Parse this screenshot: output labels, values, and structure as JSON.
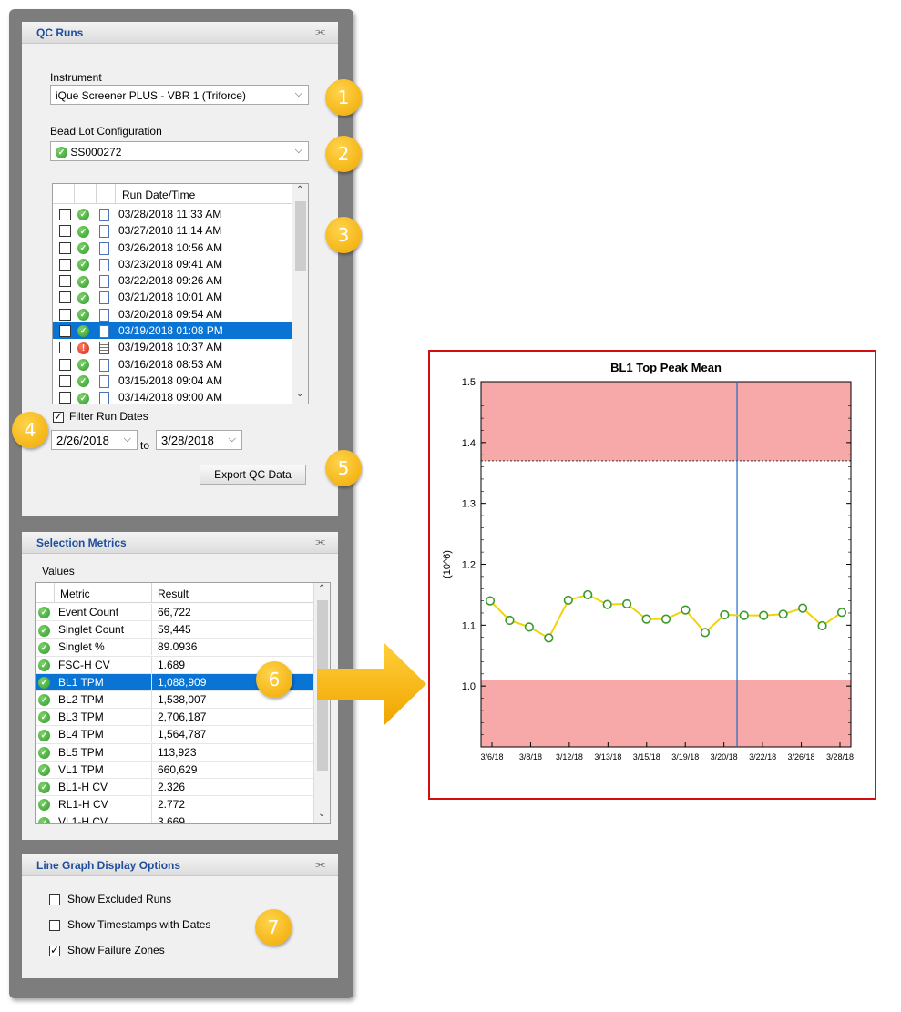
{
  "qc_runs": {
    "header": "QC Runs",
    "collapse_icon": "double-chevron-up-icon",
    "instrument_label": "Instrument",
    "instrument_value": "iQue Screener PLUS - VBR 1 (Triforce)",
    "bead_lot_label": "Bead Lot Configuration",
    "bead_lot_value": "SS000272",
    "runs_header": "Run Date/Time",
    "runs": [
      {
        "date": "03/28/2018 11:33 AM",
        "status": "ok",
        "selected": false
      },
      {
        "date": "03/27/2018 11:14 AM",
        "status": "ok",
        "selected": false
      },
      {
        "date": "03/26/2018 10:56 AM",
        "status": "ok",
        "selected": false
      },
      {
        "date": "03/23/2018 09:41 AM",
        "status": "ok",
        "selected": false
      },
      {
        "date": "03/22/2018 09:26 AM",
        "status": "ok",
        "selected": false
      },
      {
        "date": "03/21/2018 10:01 AM",
        "status": "ok",
        "selected": false
      },
      {
        "date": "03/20/2018 09:54 AM",
        "status": "ok",
        "selected": false
      },
      {
        "date": "03/19/2018 01:08 PM",
        "status": "ok",
        "selected": true
      },
      {
        "date": "03/19/2018 10:37 AM",
        "status": "error",
        "selected": false
      },
      {
        "date": "03/16/2018 08:53 AM",
        "status": "ok",
        "selected": false
      },
      {
        "date": "03/15/2018 09:04 AM",
        "status": "ok",
        "selected": false
      },
      {
        "date": "03/14/2018 09:00 AM",
        "status": "ok",
        "selected": false
      }
    ],
    "filter_label": "Filter Run Dates",
    "filter_checked": true,
    "date_from": "2/26/2018",
    "date_to_label": "to",
    "date_to": "3/28/2018",
    "export_button": "Export QC Data"
  },
  "selection_metrics": {
    "header": "Selection Metrics",
    "values_label": "Values",
    "col_metric": "Metric",
    "col_result": "Result",
    "rows": [
      {
        "metric": "Event Count",
        "result": "66,722",
        "selected": false
      },
      {
        "metric": "Singlet Count",
        "result": "59,445",
        "selected": false
      },
      {
        "metric": "Singlet %",
        "result": "89.0936",
        "selected": false
      },
      {
        "metric": "FSC-H CV",
        "result": "1.689",
        "selected": false
      },
      {
        "metric": "BL1 TPM",
        "result": "1,088,909",
        "selected": true
      },
      {
        "metric": "BL2 TPM",
        "result": "1,538,007",
        "selected": false
      },
      {
        "metric": "BL3 TPM",
        "result": "2,706,187",
        "selected": false
      },
      {
        "metric": "BL4 TPM",
        "result": "1,564,787",
        "selected": false
      },
      {
        "metric": "BL5 TPM",
        "result": "113,923",
        "selected": false
      },
      {
        "metric": "VL1 TPM",
        "result": "660,629",
        "selected": false
      },
      {
        "metric": "BL1-H CV",
        "result": "2.326",
        "selected": false
      },
      {
        "metric": "RL1-H CV",
        "result": "2.772",
        "selected": false
      },
      {
        "metric": "VL1-H CV",
        "result": "3.669",
        "selected": false
      }
    ]
  },
  "line_graph_options": {
    "header": "Line Graph Display Options",
    "options": [
      {
        "label": "Show Excluded Runs",
        "checked": false
      },
      {
        "label": "Show Timestamps with Dates",
        "checked": false
      },
      {
        "label": "Show Failure Zones",
        "checked": true
      }
    ]
  },
  "callouts": [
    "1",
    "2",
    "3",
    "4",
    "5",
    "6",
    "7"
  ],
  "colors": {
    "accent": "#1f4e9c",
    "selection": "#0a74d4",
    "callout": "#f5b301",
    "failure_zone": "#f7a8a8",
    "line": "#f2d30a",
    "marker": "#3a9a2a",
    "frame": "#d10f0f"
  },
  "chart_data": {
    "type": "line",
    "title": "BL1 Top Peak Mean",
    "ylabel": "(10^6)",
    "ylim": [
      0.9,
      1.5
    ],
    "yticks": [
      "1.0",
      "1.1",
      "1.2",
      "1.3",
      "1.4",
      "1.5"
    ],
    "xtick_labels": [
      "3/6/18",
      "3/8/18",
      "3/12/18",
      "3/13/18",
      "3/15/18",
      "3/19/18",
      "3/20/18",
      "3/22/18",
      "3/26/18",
      "3/28/18"
    ],
    "failure_zones": [
      [
        1.37,
        1.5
      ],
      [
        0.9,
        1.01
      ]
    ],
    "selected_index": 13,
    "series": [
      {
        "values": [
          1.14,
          1.108,
          1.097,
          1.079,
          1.141,
          1.15,
          1.134,
          1.135,
          1.11,
          1.11,
          1.125,
          1.088,
          1.117,
          1.116,
          1.116,
          1.118,
          1.128,
          1.099,
          1.121
        ]
      }
    ]
  }
}
